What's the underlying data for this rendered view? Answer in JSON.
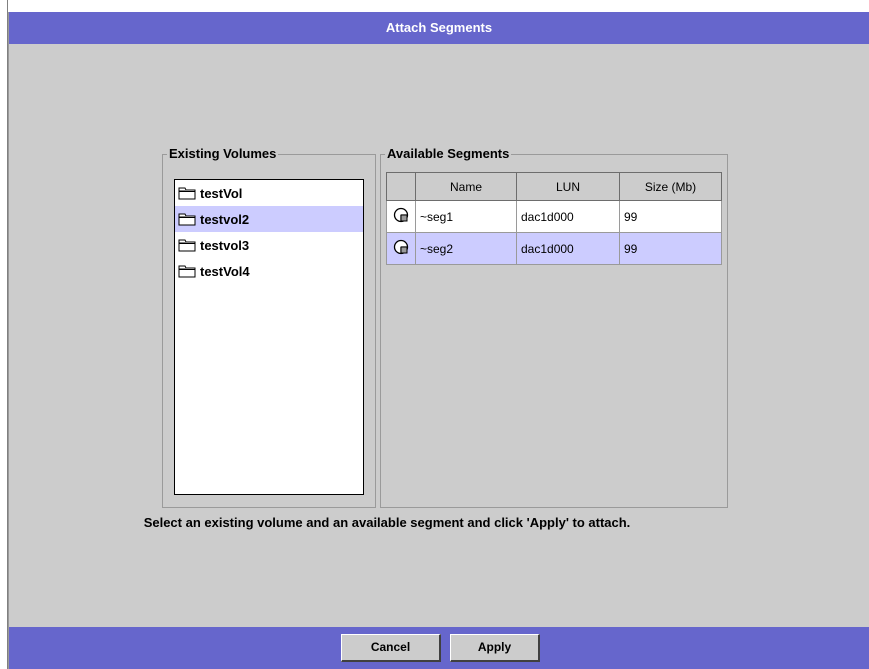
{
  "dialog": {
    "title": "Attach Segments",
    "hint": "Select an existing volume and an available segment and click 'Apply' to attach.",
    "cancel_label": "Cancel",
    "apply_label": "Apply"
  },
  "volumes": {
    "group_title": "Existing Volumes",
    "items": [
      {
        "label": "testVol",
        "selected": false
      },
      {
        "label": "testvol2",
        "selected": true
      },
      {
        "label": "testvol3",
        "selected": false
      },
      {
        "label": "testVol4",
        "selected": false
      }
    ],
    "icon": "folder-icon"
  },
  "segments": {
    "group_title": "Available Segments",
    "columns": [
      "",
      "Name",
      "LUN",
      "Size (Mb)"
    ],
    "rows": [
      {
        "icon": "segment-icon",
        "name": "~seg1",
        "lun": "dac1d000",
        "size": "99",
        "selected": false
      },
      {
        "icon": "segment-icon",
        "name": "~seg2",
        "lun": "dac1d000",
        "size": "99",
        "selected": true
      }
    ]
  },
  "colors": {
    "titlebar": "#6666cc",
    "selection": "#ccccff",
    "panel": "#cccccc"
  }
}
